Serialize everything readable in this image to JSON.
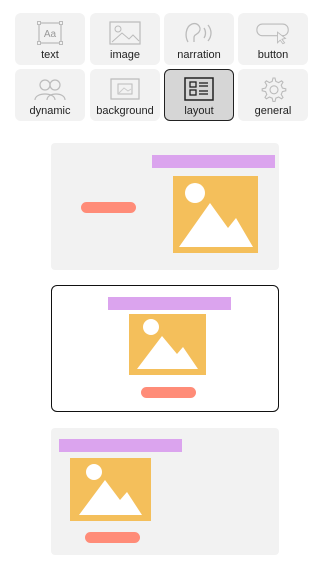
{
  "toolbar": {
    "items": [
      {
        "label": "text",
        "icon": "text-icon"
      },
      {
        "label": "image",
        "icon": "image-icon"
      },
      {
        "label": "narration",
        "icon": "narration-icon"
      },
      {
        "label": "button",
        "icon": "button-icon"
      },
      {
        "label": "dynamic",
        "icon": "dynamic-icon"
      },
      {
        "label": "background",
        "icon": "background-icon"
      },
      {
        "label": "layout",
        "icon": "layout-icon",
        "selected": true
      },
      {
        "label": "general",
        "icon": "gear-icon"
      }
    ]
  },
  "layouts": {
    "options": [
      {
        "name": "title-top-right-image-right-button-left",
        "selected": false
      },
      {
        "name": "title-image-button-centered",
        "selected": true
      },
      {
        "name": "title-top-left-image-left-button-below",
        "selected": false
      }
    ]
  },
  "colors": {
    "title_bar": "#dba4ee",
    "button_bar": "#ff8c78",
    "image_placeholder": "#f4bf5b",
    "card_background": "#f2f2f2",
    "selected_tool_background": "#d6d6d6"
  }
}
